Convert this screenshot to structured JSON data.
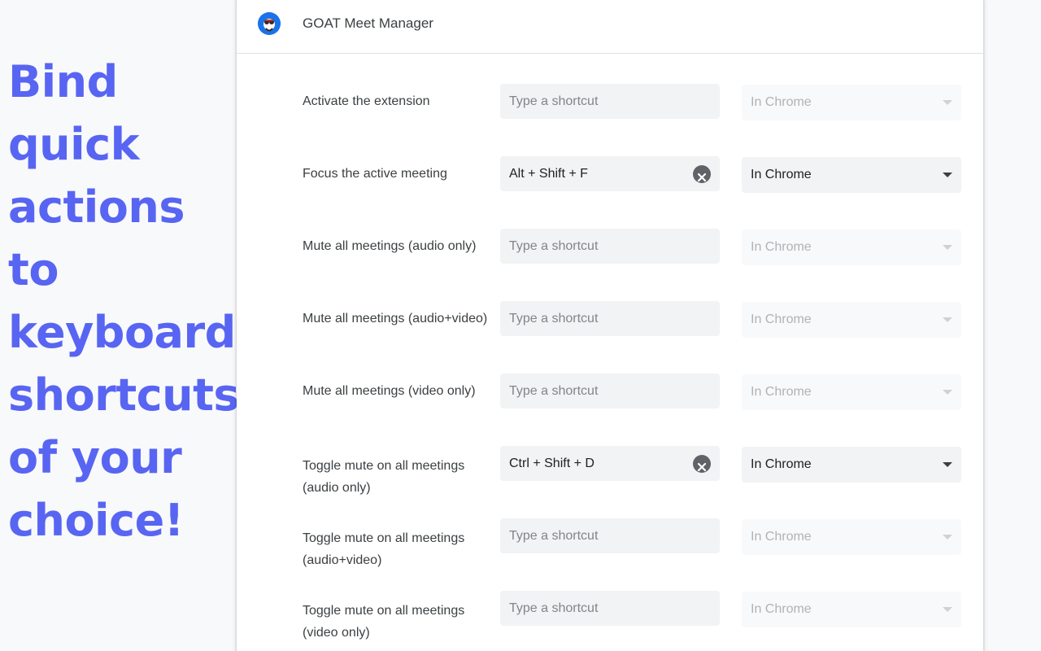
{
  "promo": {
    "lines": [
      "Bind",
      "quick",
      "actions to",
      "keyboard",
      "shortcuts",
      "of your",
      "choice!"
    ]
  },
  "header": {
    "title": "GOAT Meet Manager",
    "icon": "goat-logo-icon"
  },
  "rows": [
    {
      "label": "Activate the extension",
      "shortcut_value": "",
      "placeholder": "Type a shortcut",
      "scope": "In Chrome",
      "enabled": false
    },
    {
      "label": "Focus the active meeting",
      "shortcut_value": "Alt + Shift + F",
      "placeholder": "Type a shortcut",
      "scope": "In Chrome",
      "enabled": true
    },
    {
      "label": "Mute all meetings (audio only)",
      "shortcut_value": "",
      "placeholder": "Type a shortcut",
      "scope": "In Chrome",
      "enabled": false
    },
    {
      "label": "Mute all meetings (audio+video)",
      "shortcut_value": "",
      "placeholder": "Type a shortcut",
      "scope": "In Chrome",
      "enabled": false
    },
    {
      "label": "Mute all meetings (video only)",
      "shortcut_value": "",
      "placeholder": "Type a shortcut",
      "scope": "In Chrome",
      "enabled": false
    },
    {
      "label": "Toggle mute on all meetings (audio only)",
      "shortcut_value": "Ctrl + Shift + D",
      "placeholder": "Type a shortcut",
      "scope": "In Chrome",
      "enabled": true
    },
    {
      "label": "Toggle mute on all meetings (audio+video)",
      "shortcut_value": "",
      "placeholder": "Type a shortcut",
      "scope": "In Chrome",
      "enabled": false
    },
    {
      "label": "Toggle mute on all meetings (video only)",
      "shortcut_value": "",
      "placeholder": "Type a shortcut",
      "scope": "In Chrome",
      "enabled": false
    }
  ],
  "colors": {
    "promo_text": "#5865f2",
    "label_text": "#3c4043",
    "field_bg": "#f1f3f4",
    "placeholder": "#80868b",
    "disabled_text": "#b0b3b6"
  }
}
